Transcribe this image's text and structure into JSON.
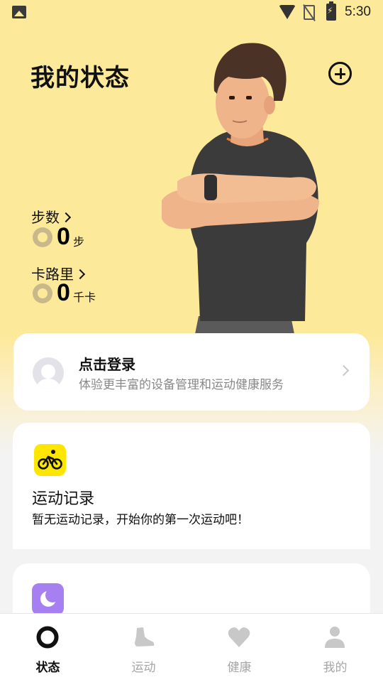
{
  "status_bar": {
    "time": "5:30",
    "icons": [
      "gallery-icon",
      "wifi-icon",
      "no-sim-icon",
      "battery-charging-icon"
    ]
  },
  "header": {
    "title": "我的状态",
    "add_icon": "add-circle-icon"
  },
  "metrics": {
    "steps": {
      "label": "步数",
      "value": "0",
      "unit": "步"
    },
    "calories": {
      "label": "卡路里",
      "value": "0",
      "unit": "千卡"
    }
  },
  "login_card": {
    "title": "点击登录",
    "subtitle": "体验更丰富的设备管理和运动健康服务"
  },
  "record_card": {
    "title": "运动记录",
    "subtitle": "暂无运动记录，开始你的第一次运动吧！",
    "icon": "cycling-icon"
  },
  "sleep_card": {
    "icon": "moon-icon"
  },
  "bottom_nav": {
    "items": [
      {
        "label": "状态",
        "icon": "status-ring-icon",
        "active": true
      },
      {
        "label": "运动",
        "icon": "shoe-icon",
        "active": false
      },
      {
        "label": "健康",
        "icon": "heart-icon",
        "active": false
      },
      {
        "label": "我的",
        "icon": "person-icon",
        "active": false
      }
    ]
  },
  "colors": {
    "hero_background": "#fde99a",
    "accent_yellow": "#fde600",
    "sleep_purple": "#a67ff0",
    "inactive_nav": "#a6a6a6"
  }
}
